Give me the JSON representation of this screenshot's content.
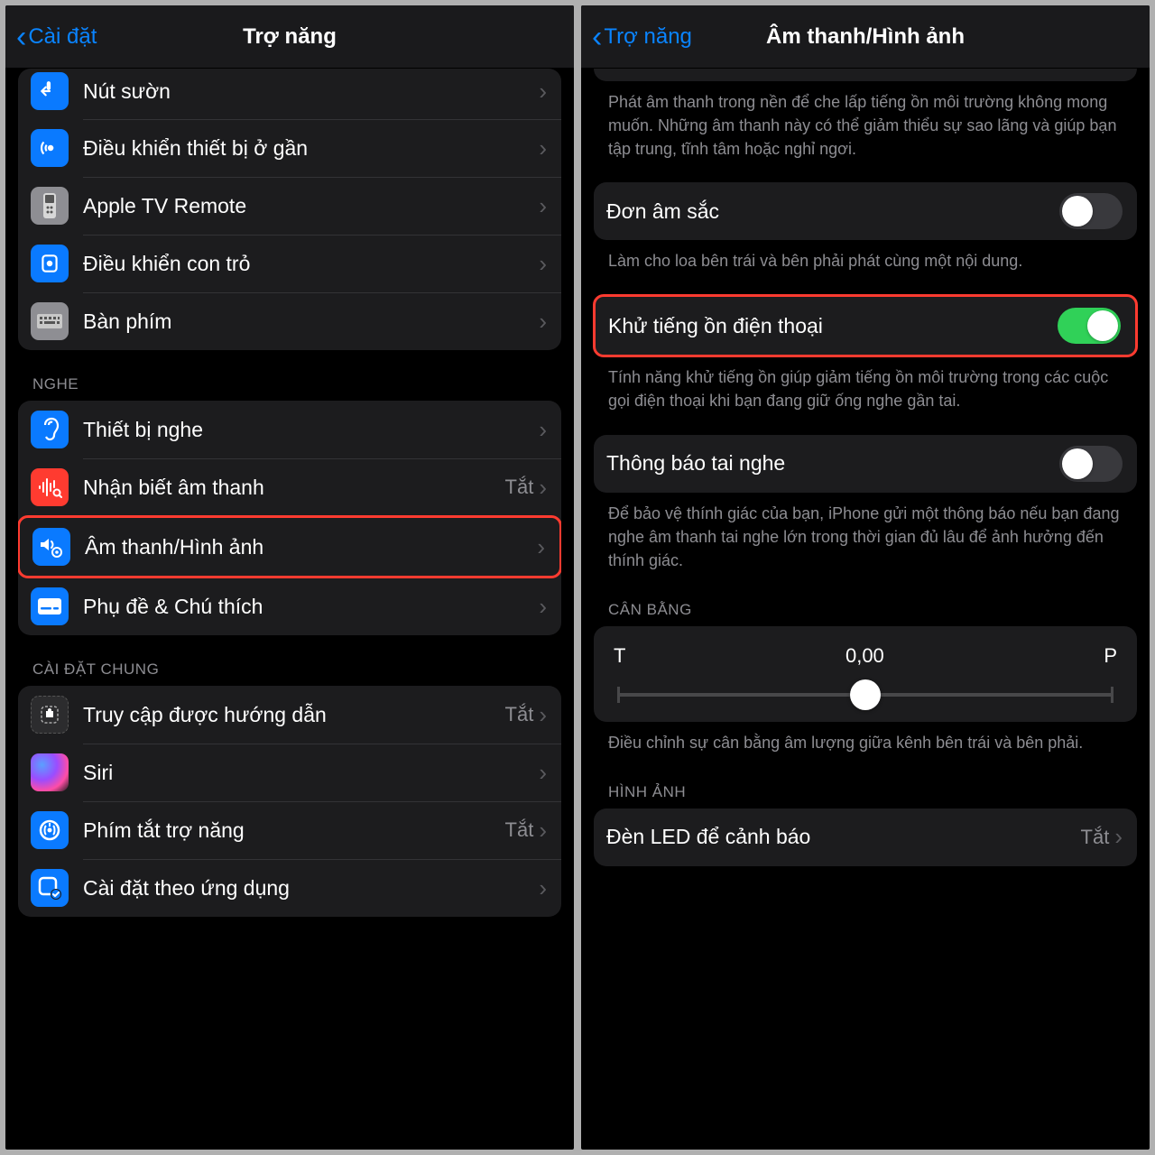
{
  "left": {
    "back": "Cài đặt",
    "title": "Trợ năng",
    "section1": [
      {
        "icon": "side-button",
        "bg": "bg-blue",
        "label": "Nút sườn"
      },
      {
        "icon": "nearby",
        "bg": "bg-blue",
        "label": "Điều khiển thiết bị ở gần"
      },
      {
        "icon": "tv-remote",
        "bg": "bg-gray",
        "label": "Apple TV Remote"
      },
      {
        "icon": "pointer",
        "bg": "bg-blue",
        "label": "Điều khiển con trỏ"
      },
      {
        "icon": "keyboard",
        "bg": "bg-gray",
        "label": "Bàn phím"
      }
    ],
    "header2": "NGHE",
    "section2": [
      {
        "icon": "ear",
        "bg": "bg-blue",
        "label": "Thiết bị nghe"
      },
      {
        "icon": "sound-rec",
        "bg": "bg-red",
        "label": "Nhận biết âm thanh",
        "value": "Tắt"
      },
      {
        "icon": "audio-visual",
        "bg": "bg-blue",
        "label": "Âm thanh/Hình ảnh",
        "highlight": true
      },
      {
        "icon": "subtitles",
        "bg": "bg-blue",
        "label": "Phụ đề & Chú thích"
      }
    ],
    "header3": "CÀI ĐẶT CHUNG",
    "section3": [
      {
        "icon": "guided",
        "bg": "bg-black",
        "label": "Truy cập được hướng dẫn",
        "value": "Tắt"
      },
      {
        "icon": "siri",
        "bg": "bg-siri",
        "label": "Siri"
      },
      {
        "icon": "shortcut",
        "bg": "bg-blue",
        "label": "Phím tắt trợ năng",
        "value": "Tắt"
      },
      {
        "icon": "per-app",
        "bg": "bg-blue",
        "label": "Cài đặt theo ứng dụng"
      }
    ]
  },
  "right": {
    "back": "Trợ năng",
    "title": "Âm thanh/Hình ảnh",
    "intro_footer": "Phát âm thanh trong nền để che lấp tiếng ồn môi trường không mong muốn. Những âm thanh này có thể giảm thiểu sự sao lãng và giúp bạn tập trung, tĩnh tâm hoặc nghỉ ngơi.",
    "mono": {
      "label": "Đơn âm sắc",
      "on": false
    },
    "mono_footer": "Làm cho loa bên trái và bên phải phát cùng một nội dung.",
    "noise": {
      "label": "Khử tiếng ồn điện thoại",
      "on": true
    },
    "noise_footer": "Tính năng khử tiếng ồn giúp giảm tiếng ồn môi trường trong các cuộc gọi điện thoại khi bạn đang giữ ống nghe gần tai.",
    "headphone": {
      "label": "Thông báo tai nghe",
      "on": false
    },
    "headphone_footer": "Để bảo vệ thính giác của bạn, iPhone gửi một thông báo nếu bạn đang nghe âm thanh tai nghe lớn trong thời gian đủ lâu để ảnh hưởng đến thính giác.",
    "balance_header": "CÂN BẰNG",
    "balance": {
      "left": "T",
      "value": "0,00",
      "right": "P"
    },
    "balance_footer": "Điều chỉnh sự cân bằng âm lượng giữa kênh bên trái và bên phải.",
    "image_header": "HÌNH ẢNH",
    "led": {
      "label": "Đèn LED để cảnh báo",
      "value": "Tắt"
    }
  }
}
